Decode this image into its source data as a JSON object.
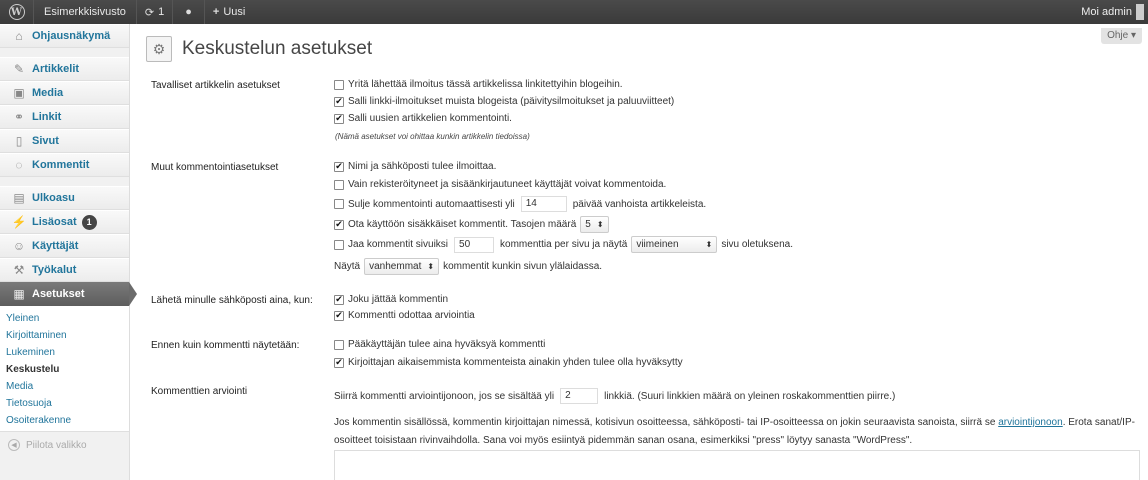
{
  "adminbar": {
    "site_name": "Esimerkkisivusto",
    "updates_count": "1",
    "new_label": "Uusi",
    "greeting": "Moi admin"
  },
  "sidebar": {
    "items": [
      {
        "label": "Ohjausnäkymä",
        "icon": "dashboard-icon"
      },
      {
        "label": "Artikkelit",
        "icon": "pin-icon"
      },
      {
        "label": "Media",
        "icon": "media-icon"
      },
      {
        "label": "Linkit",
        "icon": "link-icon"
      },
      {
        "label": "Sivut",
        "icon": "pages-icon"
      },
      {
        "label": "Kommentit",
        "icon": "comments-icon"
      },
      {
        "label": "Ulkoasu",
        "icon": "appearance-icon"
      },
      {
        "label": "Lisäosat",
        "icon": "plugins-icon",
        "badge": "1"
      },
      {
        "label": "Käyttäjät",
        "icon": "users-icon"
      },
      {
        "label": "Työkalut",
        "icon": "tools-icon"
      },
      {
        "label": "Asetukset",
        "icon": "settings-icon"
      }
    ],
    "submenu": [
      "Yleinen",
      "Kirjoittaminen",
      "Lukeminen",
      "Keskustelu",
      "Media",
      "Tietosuoja",
      "Osoiterakenne"
    ],
    "collapse_label": "Piilota valikko"
  },
  "help_tab": "Ohje",
  "page_title": "Keskustelun asetukset",
  "sections": {
    "default_article": {
      "label": "Tavalliset artikkelin asetukset",
      "opt1": "Yritä lähettää ilmoitus tässä artikkelissa linkitettyihin blogeihin.",
      "opt2": "Salli linkki-ilmoitukset muista blogeista (päivitysilmoitukset ja paluuviitteet)",
      "opt3": "Salli uusien artikkelien kommentointi.",
      "note": "(Nämä asetukset voi ohittaa kunkin artikkelin tiedoissa)"
    },
    "other_comment": {
      "label": "Muut kommentointiasetukset",
      "opt1": "Nimi ja sähköposti tulee ilmoittaa.",
      "opt2": "Vain rekisteröityneet ja sisäänkirjautuneet käyttäjät voivat kommentoida.",
      "opt3_pre": "Sulje kommentointi automaattisesti yli",
      "opt3_value": "14",
      "opt3_post": "päivää vanhoista artikkeleista.",
      "opt4_pre": "Ota käyttöön sisäkkäiset kommentit. Tasojen määrä",
      "opt4_value": "5",
      "opt5_pre": "Jaa kommentit sivuiksi",
      "opt5_value": "50",
      "opt5_mid": "kommenttia per sivu ja näytä",
      "opt5_select": "viimeinen",
      "opt5_post": "sivu oletuksena.",
      "opt6_pre": "Näytä",
      "opt6_select": "vanhemmat",
      "opt6_post": "kommentit kunkin sivun ylälaidassa."
    },
    "email_me": {
      "label": "Lähetä minulle sähköposti aina, kun:",
      "opt1": "Joku jättää kommentin",
      "opt2": "Kommentti odottaa arviointia"
    },
    "before_appear": {
      "label": "Ennen kuin kommentti näytetään:",
      "opt1": "Pääkäyttäjän tulee aina hyväksyä kommentti",
      "opt2": "Kirjoittajan aikaisemmista kommenteista ainakin yhden tulee olla hyväksytty"
    },
    "moderation": {
      "label": "Kommenttien arviointi",
      "line_pre": "Siirrä kommentti arviointijonoon, jos se sisältää yli",
      "line_value": "2",
      "line_post": "linkkiä. (Suuri linkkien määrä on yleinen roskakommenttien piirre.)",
      "para_pre": "Jos kommentin sisällössä, kommentin kirjoittajan nimessä, kotisivun osoitteessa, sähköposti- tai IP-osoitteessa on jokin seuraavista sanoista, siirrä se",
      "para_link": "arviointijonoon",
      "para_post": ". Erota sanat/IP-osoitteet toisistaan rivinvaihdolla. Sana voi myös esiintyä pidemmän sanan osana, esimerkiksi \"press\" löytyy sanasta \"WordPress\"."
    }
  }
}
